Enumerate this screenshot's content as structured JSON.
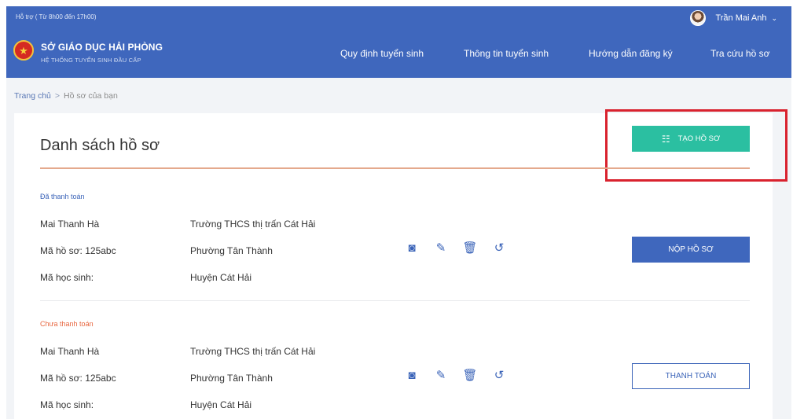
{
  "topbar": {
    "support_text": "Hỗ trợ ( Từ 8h00 đến 17h00)",
    "user_name": "Trần Mai Anh",
    "chevron": "⌄"
  },
  "header": {
    "emblem_glyph": "★",
    "title": "SỞ GIÁO DỤC HẢI PHÒNG",
    "subtitle": "HỆ THỐNG TUYỂN SINH ĐẦU CẤP",
    "nav": [
      {
        "label": "Quy định tuyển sinh"
      },
      {
        "label": "Thông tin tuyển sinh"
      },
      {
        "label": "Hướng dẫn đăng ký"
      },
      {
        "label": "Tra cứu hồ sơ"
      }
    ]
  },
  "breadcrumb": {
    "home": "Trang chủ",
    "separator": ">",
    "current": "Hồ sơ của bạn"
  },
  "card": {
    "title": "Danh sách hồ sơ",
    "create_button": "TẠO HỒ SƠ",
    "create_icon": "☷"
  },
  "icons": {
    "view": "◙",
    "edit": "✎",
    "delete": "🗑",
    "history": "↺"
  },
  "records": [
    {
      "status": "Đã thanh toán",
      "name": "Mai Thanh Hà",
      "code": "Mã hồ sơ: 125abc",
      "student_id": "Mã học sinh:",
      "school": "Trường THCS thị trấn Cát Hải",
      "ward": "Phường Tân Thành",
      "district": "Huyện Cát Hải",
      "action_label": "NỘP HỒ SƠ"
    },
    {
      "status": "Chưa thanh toán",
      "name": "Mai Thanh Hà",
      "code": "Mã hồ sơ: 125abc",
      "student_id": "Mã học sinh:",
      "school": "Trường THCS thị trấn Cát Hải",
      "ward": "Phường Tân Thành",
      "district": "Huyện Cát Hải",
      "action_label": "THANH TOÁN"
    }
  ],
  "colors": {
    "primary": "#3f67bd",
    "accent": "#2bbfa1",
    "paid": "#3a63b8",
    "unpaid": "#e8663f",
    "highlight": "#d9222e"
  }
}
